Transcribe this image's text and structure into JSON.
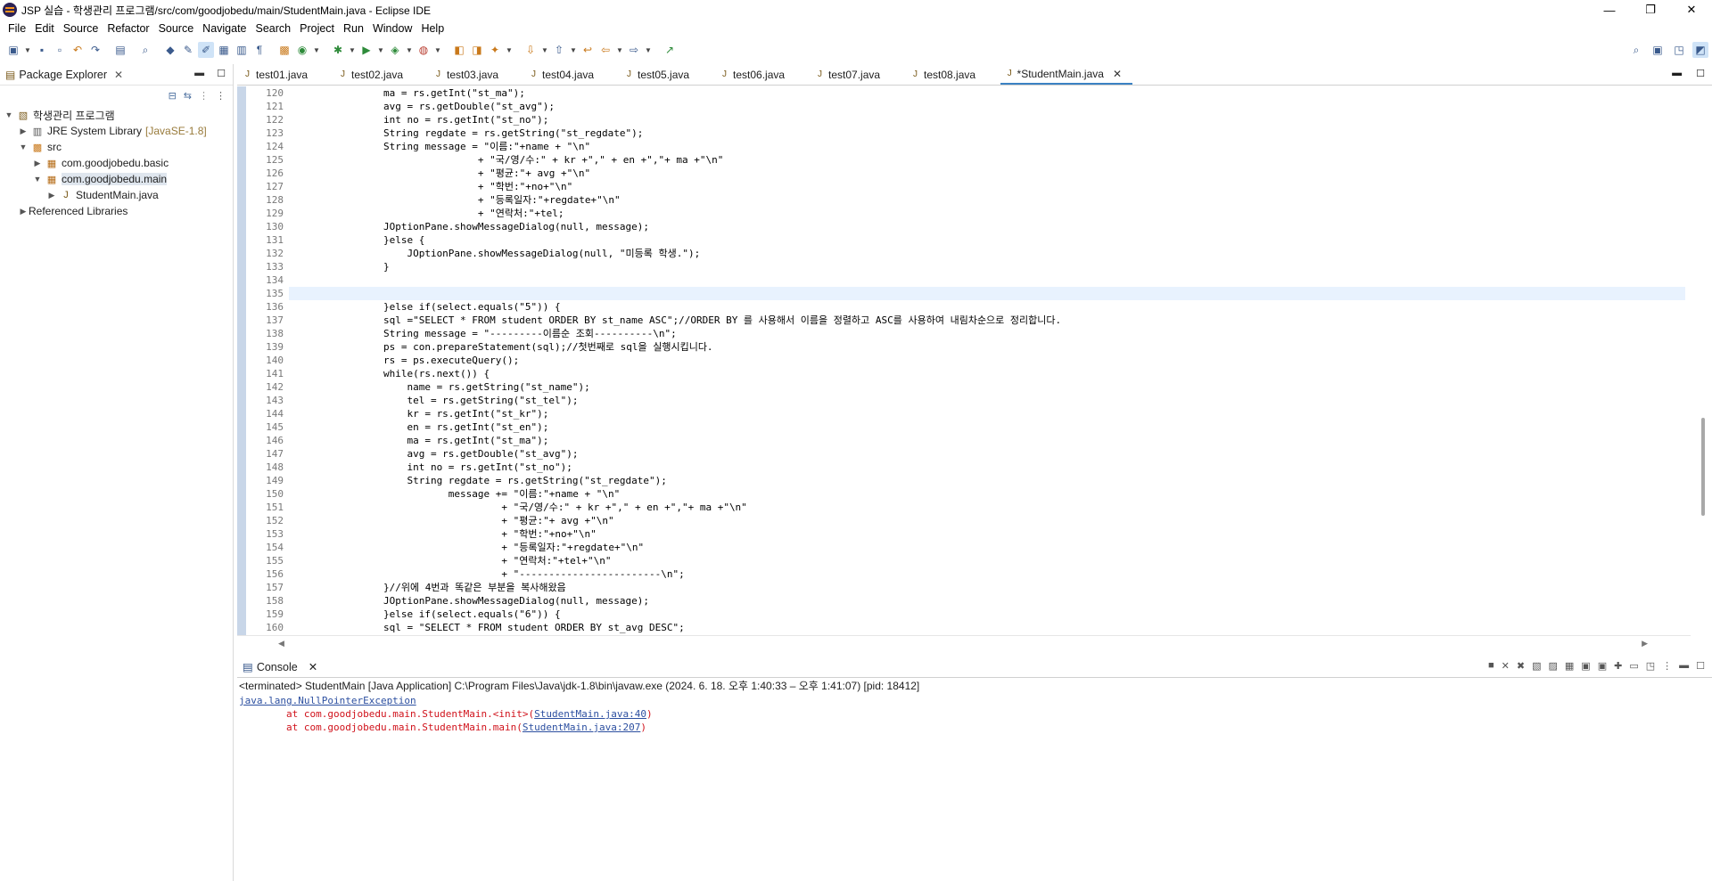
{
  "window": {
    "title": "JSP 실습 - 학생관리 프로그램/src/com/goodjobedu/main/StudentMain.java - Eclipse IDE",
    "minimize": "—",
    "maximize": "❐",
    "close": "✕"
  },
  "menu": [
    "File",
    "Edit",
    "Source",
    "Refactor",
    "Source",
    "Navigate",
    "Search",
    "Project",
    "Run",
    "Window",
    "Help"
  ],
  "package_explorer": {
    "title": "Package Explorer",
    "tree": [
      {
        "label": "학생관리 프로그램",
        "level": 0,
        "expanded": true
      },
      {
        "label": "JRE System Library",
        "suffix": "[JavaSE-1.8]",
        "level": 1,
        "expanded": false
      },
      {
        "label": "src",
        "level": 1,
        "expanded": true
      },
      {
        "label": "com.goodjobedu.basic",
        "level": 2,
        "expanded": false
      },
      {
        "label": "com.goodjobedu.main",
        "level": 2,
        "expanded": true,
        "selected": true
      },
      {
        "label": "StudentMain.java",
        "level": 3,
        "expanded": false
      },
      {
        "label": "Referenced Libraries",
        "level": 1,
        "expanded": false
      }
    ]
  },
  "editor": {
    "tabs": [
      "test01.java",
      "test02.java",
      "test03.java",
      "test04.java",
      "test05.java",
      "test06.java",
      "test07.java",
      "test08.java",
      "*StudentMain.java"
    ],
    "active_tab": "*StudentMain.java",
    "current_line": 135,
    "lines": [
      {
        "n": "120",
        "t": "                ma = rs.getInt(\"st_ma\");"
      },
      {
        "n": "121",
        "t": "                avg = rs.getDouble(\"st_avg\");"
      },
      {
        "n": "122",
        "t": "                int no = rs.getInt(\"st_no\");"
      },
      {
        "n": "123",
        "t": "                String regdate = rs.getString(\"st_regdate\");"
      },
      {
        "n": "124",
        "t": "                String message = \"이름:\"+name + \"\\n\""
      },
      {
        "n": "125",
        "t": "                                + \"국/영/수:\" + kr +\",\" + en +\",\"+ ma +\"\\n\""
      },
      {
        "n": "126",
        "t": "                                + \"평균:\"+ avg +\"\\n\""
      },
      {
        "n": "127",
        "t": "                                + \"학번:\"+no+\"\\n\""
      },
      {
        "n": "128",
        "t": "                                + \"등록일자:\"+regdate+\"\\n\""
      },
      {
        "n": "129",
        "t": "                                + \"연락처:\"+tel;"
      },
      {
        "n": "130",
        "t": "                JOptionPane.showMessageDialog(null, message);"
      },
      {
        "n": "131",
        "t": "                }else {"
      },
      {
        "n": "132",
        "t": "                    JOptionPane.showMessageDialog(null, \"미등록 학생.\");"
      },
      {
        "n": "133",
        "t": "                }"
      },
      {
        "n": "134",
        "t": ""
      },
      {
        "n": "135",
        "t": "                "
      },
      {
        "n": "136",
        "t": "                }else if(select.equals(\"5\")) {"
      },
      {
        "n": "137",
        "t": "                sql =\"SELECT * FROM student ORDER BY st_name ASC\";//ORDER BY 를 사용해서 이름을 정렬하고 ASC를 사용하여 내림차순으로 정리합니다."
      },
      {
        "n": "138",
        "t": "                String message = \"---------이름순 조회----------\\n\";"
      },
      {
        "n": "139",
        "t": "                ps = con.prepareStatement(sql);//첫번째로 sql을 실행시킵니다."
      },
      {
        "n": "140",
        "t": "                rs = ps.executeQuery();"
      },
      {
        "n": "141",
        "t": "                while(rs.next()) {"
      },
      {
        "n": "142",
        "t": "                    name = rs.getString(\"st_name\");"
      },
      {
        "n": "143",
        "t": "                    tel = rs.getString(\"st_tel\");"
      },
      {
        "n": "144",
        "t": "                    kr = rs.getInt(\"st_kr\");"
      },
      {
        "n": "145",
        "t": "                    en = rs.getInt(\"st_en\");"
      },
      {
        "n": "146",
        "t": "                    ma = rs.getInt(\"st_ma\");"
      },
      {
        "n": "147",
        "t": "                    avg = rs.getDouble(\"st_avg\");"
      },
      {
        "n": "148",
        "t": "                    int no = rs.getInt(\"st_no\");"
      },
      {
        "n": "149",
        "t": "                    String regdate = rs.getString(\"st_regdate\");"
      },
      {
        "n": "150",
        "t": "                           message += \"이름:\"+name + \"\\n\""
      },
      {
        "n": "151",
        "t": "                                    + \"국/영/수:\" + kr +\",\" + en +\",\"+ ma +\"\\n\""
      },
      {
        "n": "152",
        "t": "                                    + \"평균:\"+ avg +\"\\n\""
      },
      {
        "n": "153",
        "t": "                                    + \"학번:\"+no+\"\\n\""
      },
      {
        "n": "154",
        "t": "                                    + \"등록일자:\"+regdate+\"\\n\""
      },
      {
        "n": "155",
        "t": "                                    + \"연락처:\"+tel+\"\\n\""
      },
      {
        "n": "156",
        "t": "                                    + \"------------------------\\n\";"
      },
      {
        "n": "157",
        "t": "                }//위에 4번과 똑같은 부분을 복사해왔음"
      },
      {
        "n": "158",
        "t": "                JOptionPane.showMessageDialog(null, message);"
      },
      {
        "n": "159",
        "t": "                }else if(select.equals(\"6\")) {"
      },
      {
        "n": "160",
        "t": "                sql = \"SELECT * FROM student ORDER BY st_avg DESC\";"
      }
    ]
  },
  "console": {
    "title": "Console",
    "header": "<terminated> StudentMain [Java Application] C:\\Program Files\\Java\\jdk-1.8\\bin\\javaw.exe  (2024. 6. 18. 오후 1:40:33 – 오후 1:41:07) [pid: 18412]",
    "exception": "java.lang.NullPointerException",
    "stack": [
      {
        "prefix": "\tat com.goodjobedu.main.StudentMain.<init>(",
        "link": "StudentMain.java:40",
        "suffix": ")"
      },
      {
        "prefix": "\tat com.goodjobedu.main.StudentMain.main(",
        "link": "StudentMain.java:207",
        "suffix": ")"
      }
    ]
  }
}
